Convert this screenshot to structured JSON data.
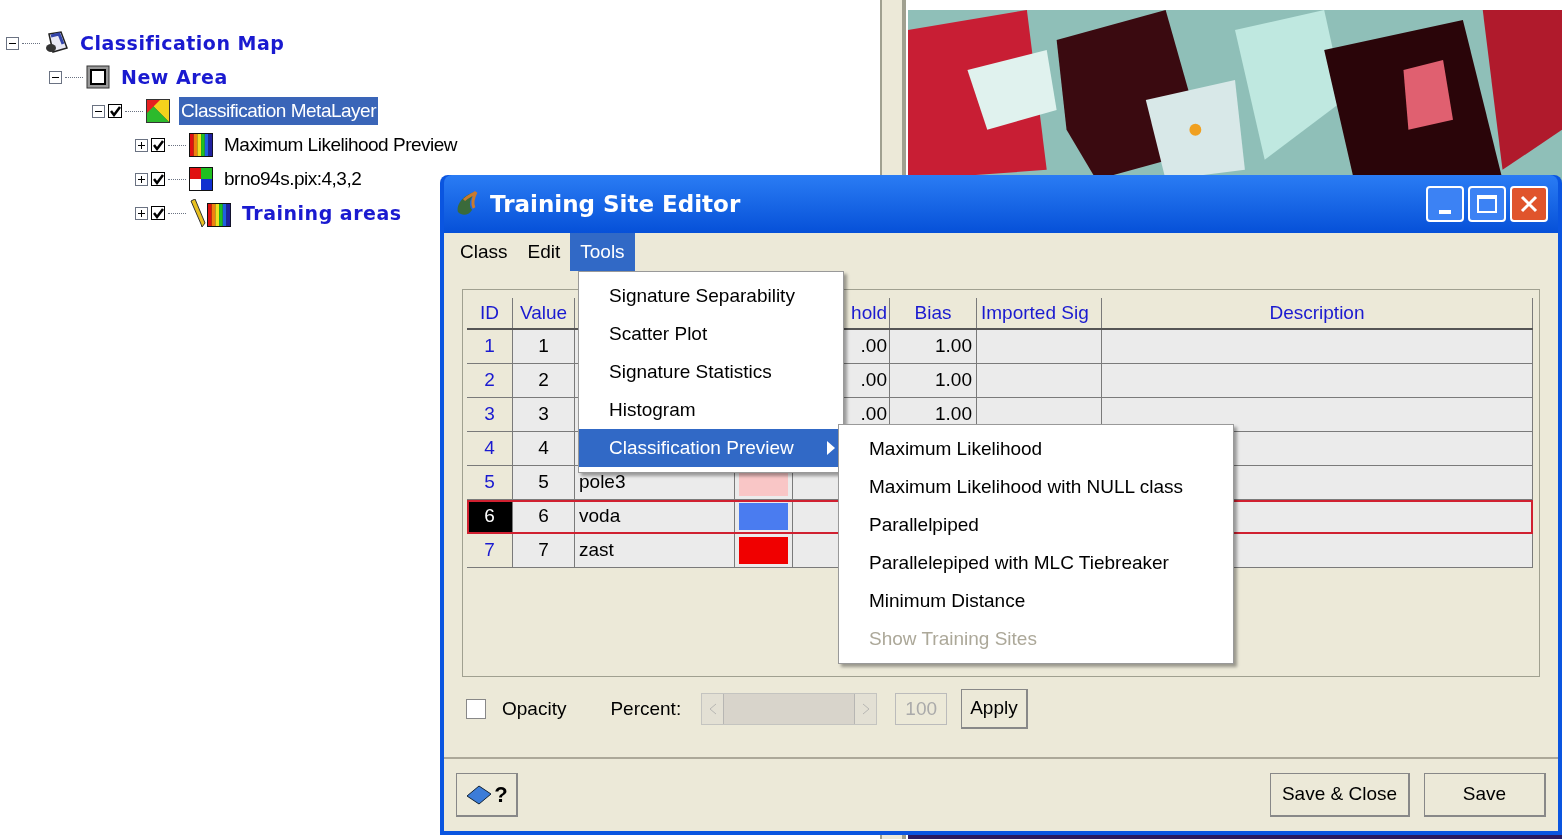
{
  "tree": [
    {
      "label": "Classification Map",
      "kind": "map",
      "expanded": true,
      "children": [
        {
          "label": "New Area",
          "kind": "area",
          "expanded": true,
          "children": [
            {
              "label": "Classification MetaLayer",
              "kind": "metalayer",
              "expanded": true,
              "checked": true,
              "selected": true,
              "children": [
                {
                  "label": "Maximum Likelihood Preview",
                  "kind": "preview",
                  "expanded": false,
                  "checked": true,
                  "selected": false
                },
                {
                  "label": "brno94s.pix:4,3,2",
                  "kind": "raster",
                  "expanded": false,
                  "checked": true,
                  "selected": false
                },
                {
                  "label": "Training areas",
                  "kind": "training",
                  "expanded": false,
                  "checked": true,
                  "selected": false
                }
              ]
            }
          ]
        }
      ]
    }
  ],
  "window": {
    "title": "Training Site Editor",
    "menu": [
      {
        "label": "Class",
        "selected": false
      },
      {
        "label": "Edit",
        "selected": false
      },
      {
        "label": "Tools",
        "selected": true
      }
    ],
    "tools_menu": [
      {
        "label": "Signature Separability",
        "selected": false,
        "submenu": false
      },
      {
        "label": "Scatter Plot",
        "selected": false,
        "submenu": false
      },
      {
        "label": "Signature Statistics",
        "selected": false,
        "submenu": false
      },
      {
        "label": "Histogram",
        "selected": false,
        "submenu": false
      },
      {
        "label": "Classification Preview",
        "selected": true,
        "submenu": true
      }
    ],
    "submenu": [
      {
        "label": "Maximum Likelihood",
        "disabled": false
      },
      {
        "label": "Maximum Likelihood with NULL class",
        "disabled": false
      },
      {
        "label": "Parallelpiped",
        "disabled": false
      },
      {
        "label": "Parallelepiped with MLC Tiebreaker",
        "disabled": false
      },
      {
        "label": "Minimum Distance",
        "disabled": false
      },
      {
        "label": "Show Training Sites",
        "disabled": true
      }
    ],
    "table": {
      "columns": [
        {
          "label": "ID"
        },
        {
          "label": "Value"
        },
        {
          "label": "hold"
        },
        {
          "label": "Bias"
        },
        {
          "label": "Imported Sig"
        },
        {
          "label": "Description"
        }
      ],
      "rows": [
        {
          "id": "1",
          "value": "1",
          "hold": ".00",
          "bias": "1.00",
          "selected": false
        },
        {
          "id": "2",
          "value": "2",
          "hold": ".00",
          "bias": "1.00",
          "selected": false
        },
        {
          "id": "3",
          "value": "3",
          "hold": ".00",
          "bias": "1.00",
          "selected": false
        },
        {
          "id": "4",
          "value": "4",
          "selected": false
        },
        {
          "id": "5",
          "value": "5",
          "name": "pole3",
          "color": "#f9c6c6",
          "selected": false
        },
        {
          "id": "6",
          "value": "6",
          "name": "voda",
          "color": "#4a7cf0",
          "selected": true
        },
        {
          "id": "7",
          "value": "7",
          "name": "zast",
          "color": "#f00000",
          "selected": false
        }
      ]
    },
    "opacity": {
      "label": "Opacity",
      "checked": false
    },
    "percent": {
      "label": "Percent:",
      "value": "100",
      "disabled": true
    },
    "apply_button": "Apply",
    "help_button": "?",
    "buttons": [
      "Save & Close",
      "Save"
    ]
  }
}
